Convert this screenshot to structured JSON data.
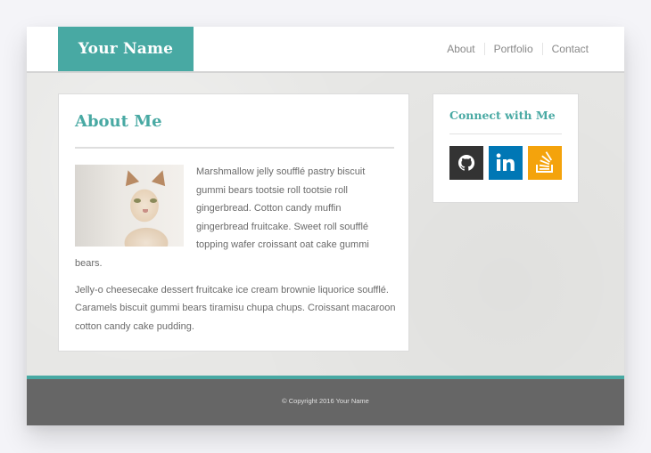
{
  "header": {
    "brand": "Your Name",
    "nav": [
      {
        "label": "About"
      },
      {
        "label": "Portfolio"
      },
      {
        "label": "Contact"
      }
    ]
  },
  "about": {
    "title": "About Me",
    "image_alt": "cat photo",
    "paragraph1": "Marshmallow jelly soufflé pastry biscuit gummi bears tootsie roll tootsie roll gingerbread. Cotton candy muffin gingerbread fruitcake. Sweet roll soufflé topping wafer croissant oat cake gummi bears.",
    "paragraph2": "Jelly-o cheesecake dessert fruitcake ice cream brownie liquorice soufflé. Caramels biscuit gummi bears tiramisu chupa chups. Croissant macaroon cotton candy cake pudding."
  },
  "connect": {
    "title": "Connect with Me",
    "links": [
      {
        "icon": "github-icon",
        "color": "#333333"
      },
      {
        "icon": "linkedin-icon",
        "color": "#0077b5"
      },
      {
        "icon": "stackoverflow-icon",
        "color": "#f4a30c"
      }
    ]
  },
  "footer": {
    "copyright": "© Copyright 2016 Your Name"
  },
  "colors": {
    "accent": "#48a9a3",
    "footer_bg": "#666666",
    "text": "#6b6b6b"
  }
}
